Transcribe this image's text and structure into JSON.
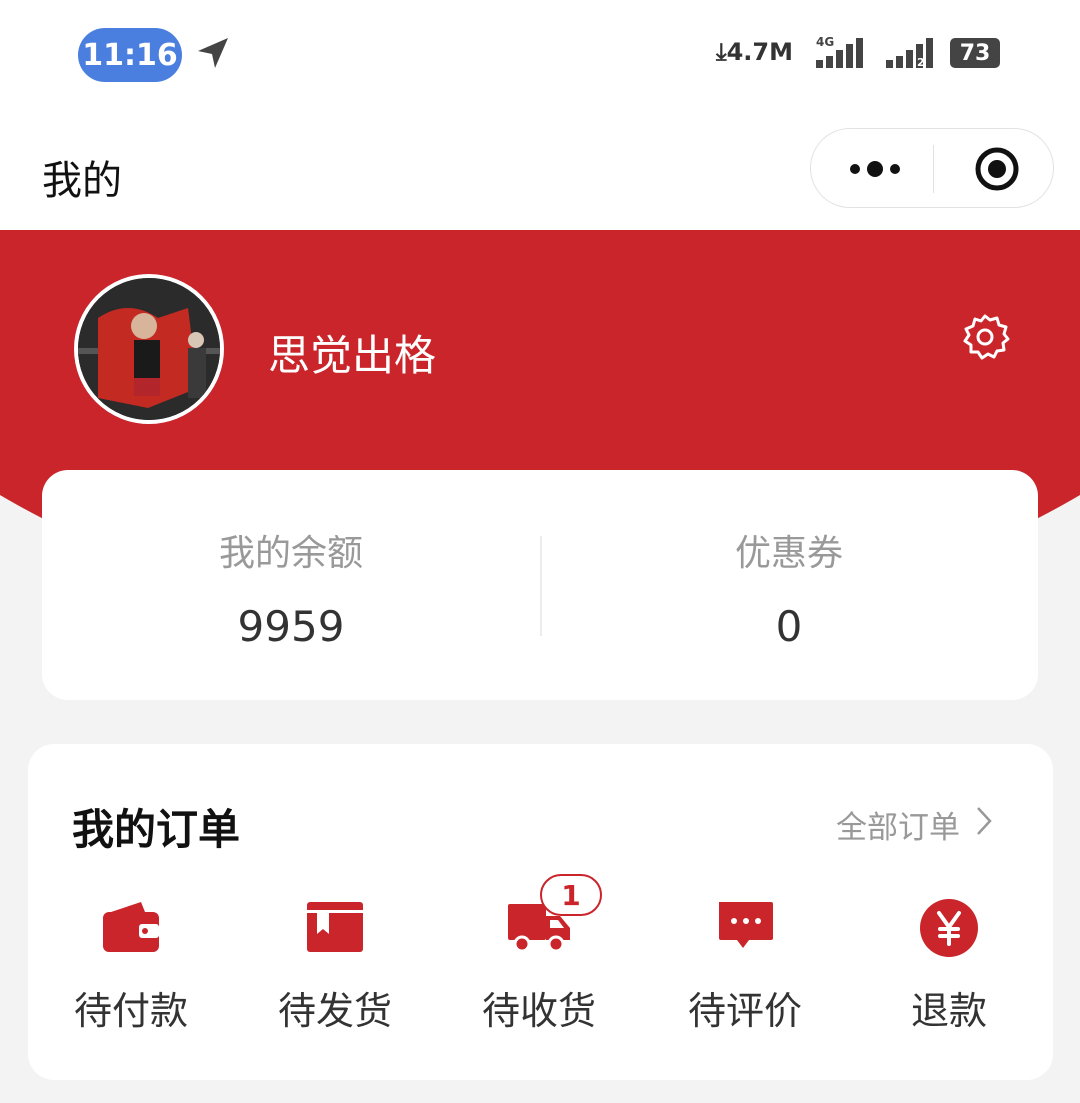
{
  "status_bar": {
    "time": "11:16",
    "net_speed": "4.7M",
    "net_type": "4G",
    "sim2": "2",
    "battery": "73",
    "icons": [
      "location-arrow-icon",
      "download-arrow-icon",
      "signal-icon",
      "battery-icon"
    ]
  },
  "nav": {
    "title": "我的",
    "capsule_icons": [
      "more-dots-icon",
      "target-circle-icon"
    ]
  },
  "profile": {
    "username": "思觉出格",
    "settings_icon": "gear-icon"
  },
  "balance": {
    "items": [
      {
        "label": "我的余额",
        "value": "9959"
      },
      {
        "label": "优惠券",
        "value": "0"
      }
    ]
  },
  "orders": {
    "title": "我的订单",
    "all_label": "全部订单",
    "items": [
      {
        "label": "待付款",
        "icon": "wallet-icon"
      },
      {
        "label": "待发货",
        "icon": "package-box-icon"
      },
      {
        "label": "待收货",
        "icon": "delivery-truck-icon",
        "badge": "1"
      },
      {
        "label": "待评价",
        "icon": "comment-bubble-icon"
      },
      {
        "label": "退款",
        "icon": "yen-circle-icon"
      }
    ]
  },
  "colors": {
    "brand_red": "#c9252b",
    "time_pill_blue": "#4a7fe0",
    "background": "#f3f3f3"
  }
}
